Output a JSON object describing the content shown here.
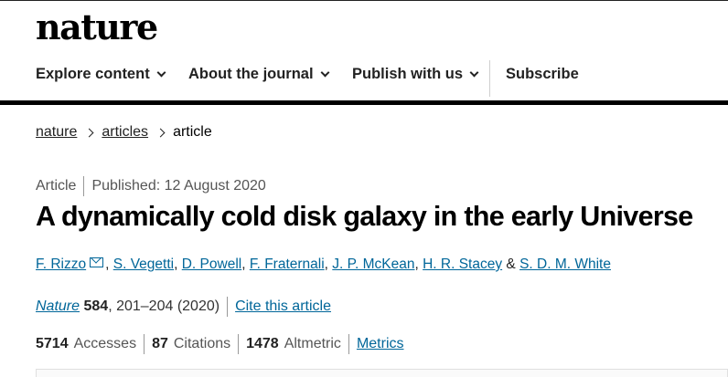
{
  "brand": {
    "logo": "nature"
  },
  "nav": {
    "items": [
      {
        "label": "Explore content"
      },
      {
        "label": "About the journal"
      },
      {
        "label": "Publish with us"
      }
    ],
    "subscribe": "Subscribe"
  },
  "breadcrumb": [
    "nature",
    "articles",
    "article"
  ],
  "article": {
    "type": "Article",
    "published": "Published: 12 August 2020",
    "title": "A dynamically cold disk galaxy in the early Universe",
    "authors": [
      "F. Rizzo",
      "S. Vegetti",
      "D. Powell",
      "F. Fraternali",
      "J. P. McKean",
      "H. R. Stacey",
      "S. D. M. White"
    ],
    "author_join_comma": ",",
    "author_join_amp": "&",
    "journal": "Nature",
    "volume": "584",
    "pages": ", 201–204 (2020)",
    "cite_label": "Cite this article"
  },
  "metrics": {
    "accesses_value": "5714",
    "accesses_label": "Accesses",
    "citations_value": "87",
    "citations_label": "Citations",
    "altmetric_value": "1478",
    "altmetric_label": "Altmetric",
    "metrics_link": "Metrics"
  },
  "colors": {
    "link": "#006699",
    "text": "#222222",
    "bar": "#000000"
  },
  "icons": {
    "author_mail": "envelope-icon",
    "nav_chevron": "chevron-down-icon",
    "breadcrumb_sep": "chevron-right-icon"
  }
}
